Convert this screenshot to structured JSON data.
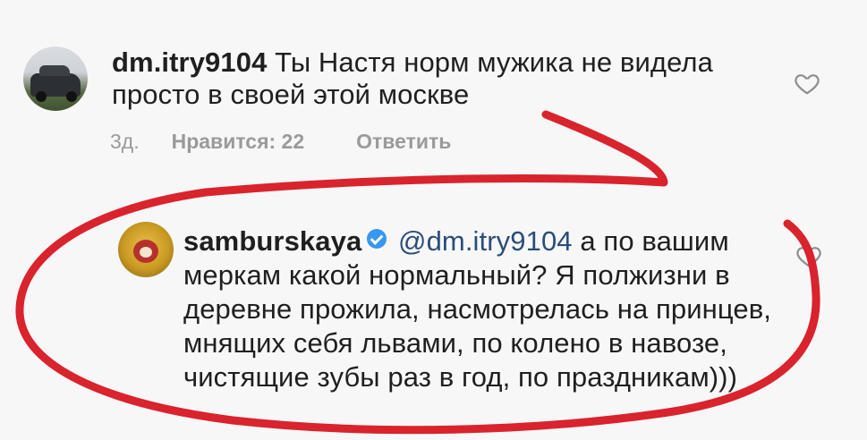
{
  "comments": [
    {
      "username": "dm.itry9104",
      "text": "Ты Настя норм мужика не видела просто в своей этой москве",
      "time": "3д.",
      "likes": "Нравится: 22",
      "reply_label": "Ответить",
      "avatar_icon": "car-photo-avatar",
      "verified": false
    },
    {
      "username": "samburskaya",
      "mention": "@dm.itry9104",
      "text": "а по вашим меркам какой нормальный? Я полжизни в деревне прожила, насмотрелась на принцев, мнящих себя львами, по колено в навозе, чистящие зубы раз в год, по праздникам)))",
      "avatar_icon": "emoji-avatar",
      "verified": true
    }
  ],
  "colors": {
    "annotation_stroke": "#d9232d",
    "verified_badge": "#3897f0",
    "meta_text": "#9a9a9a"
  }
}
